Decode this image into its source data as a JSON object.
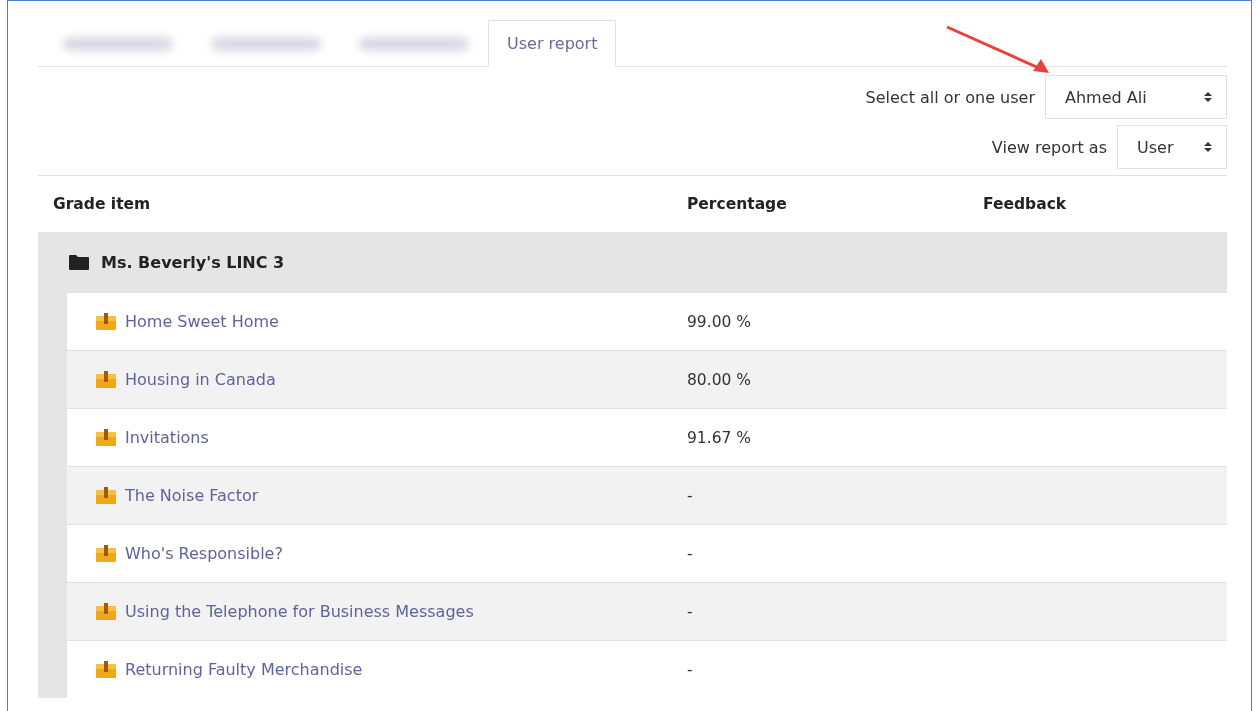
{
  "tabs": [
    {
      "kind": "redacted",
      "selected": false
    },
    {
      "kind": "redacted",
      "selected": false
    },
    {
      "kind": "redacted",
      "selected": false
    },
    {
      "kind": "label",
      "label": "User report",
      "selected": true
    }
  ],
  "selectors": [
    {
      "label": "Select all or one user",
      "value": "Ahmed Ali"
    },
    {
      "label": "View report as",
      "value": "User"
    }
  ],
  "table": {
    "columns": [
      "Grade item",
      "Percentage",
      "Feedback"
    ],
    "category": "Ms. Beverly's LINC 3",
    "rows": [
      {
        "item": "Home Sweet Home",
        "percentage": "99.00 %"
      },
      {
        "item": "Housing in Canada",
        "percentage": "80.00 %"
      },
      {
        "item": "Invitations",
        "percentage": "91.67 %"
      },
      {
        "item": "The Noise Factor",
        "percentage": "-"
      },
      {
        "item": "Who's Responsible?",
        "percentage": "-"
      },
      {
        "item": "Using the Telephone for Business Messages",
        "percentage": "-"
      },
      {
        "item": "Returning Faulty Merchandise",
        "percentage": "-"
      }
    ]
  }
}
